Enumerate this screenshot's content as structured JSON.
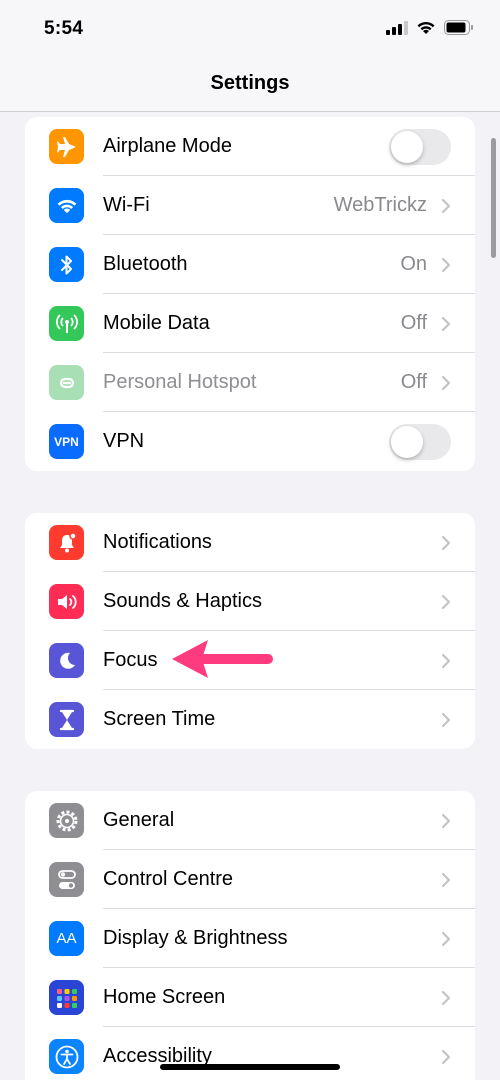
{
  "status_bar": {
    "time": "5:54",
    "icons": [
      "cellular-signal-icon",
      "wifi-icon",
      "battery-icon"
    ]
  },
  "header": {
    "title": "Settings"
  },
  "groups": [
    {
      "rows": [
        {
          "label": "Airplane Mode",
          "icon": "airplane-icon",
          "color": "#ff9500",
          "control": "toggle",
          "toggle_on": false
        },
        {
          "label": "Wi-Fi",
          "icon": "wifi-icon",
          "color": "#007aff",
          "value": "WebTrickz"
        },
        {
          "label": "Bluetooth",
          "icon": "bluetooth-icon",
          "color": "#007aff",
          "value": "On"
        },
        {
          "label": "Mobile Data",
          "icon": "antenna-icon",
          "color": "#34c759",
          "value": "Off"
        },
        {
          "label": "Personal Hotspot",
          "icon": "hotspot-icon",
          "color": "#a8dfb4",
          "value": "Off",
          "disabled": true
        },
        {
          "label": "VPN",
          "icon_text": "VPN",
          "icon": "vpn-icon",
          "color": "#0a6cff",
          "control": "toggle",
          "toggle_on": false
        }
      ]
    },
    {
      "rows": [
        {
          "label": "Notifications",
          "icon": "notification-bell-icon",
          "color": "#ff3b30"
        },
        {
          "label": "Sounds & Haptics",
          "icon": "speaker-icon",
          "color": "#ff2d55"
        },
        {
          "label": "Focus",
          "icon": "moon-icon",
          "color": "#5856d6"
        },
        {
          "label": "Screen Time",
          "icon": "hourglass-icon",
          "color": "#5856d6"
        }
      ]
    },
    {
      "rows": [
        {
          "label": "General",
          "icon": "gear-icon",
          "color": "#8e8e93"
        },
        {
          "label": "Control Centre",
          "icon": "switches-icon",
          "color": "#8e8e93"
        },
        {
          "label": "Display & Brightness",
          "icon_text": "AA",
          "icon": "text-size-icon",
          "color": "#007aff"
        },
        {
          "label": "Home Screen",
          "icon": "app-grid-icon",
          "color": "#2a45d6"
        },
        {
          "label": "Accessibility",
          "icon": "accessibility-icon",
          "color": "#0a84ff"
        }
      ]
    }
  ],
  "annotation": {
    "arrow_color": "#ff3b7f",
    "points_to": "Focus"
  }
}
